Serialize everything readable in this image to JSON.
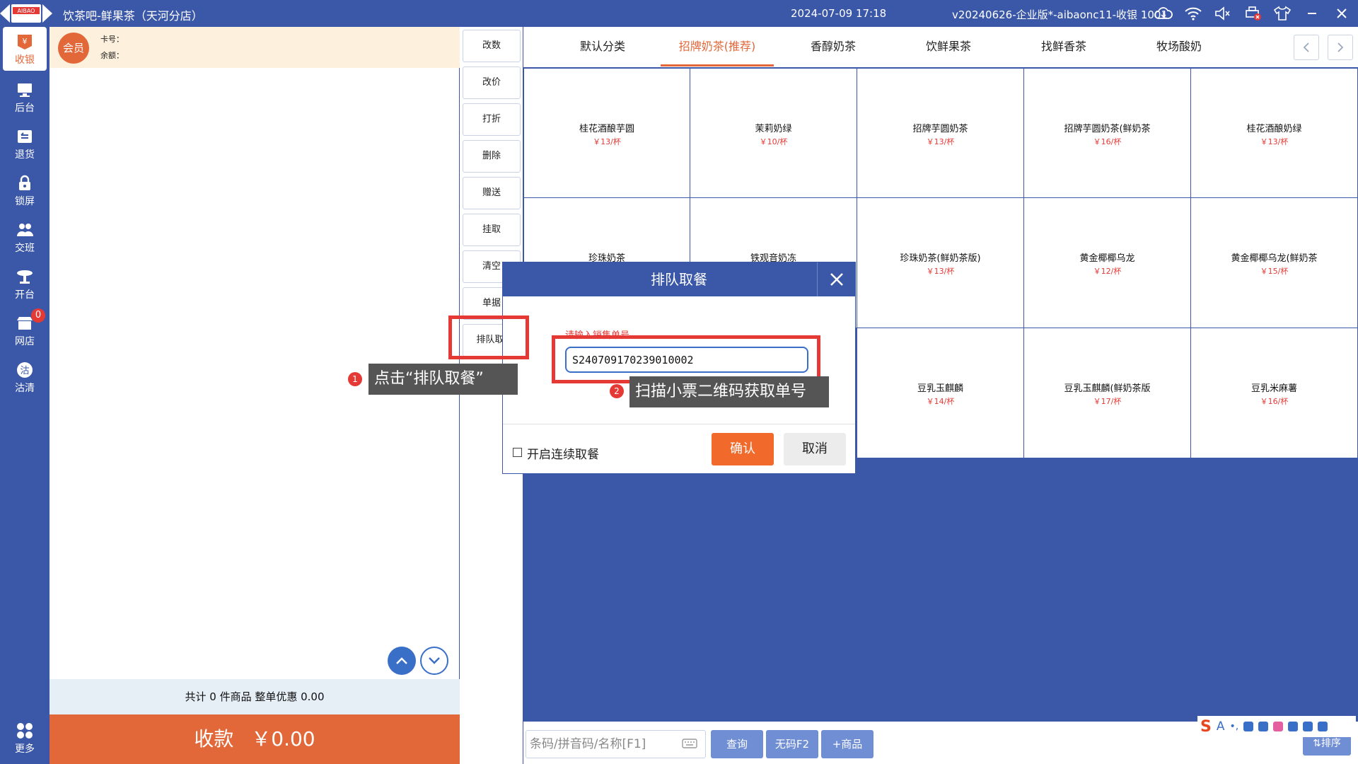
{
  "titlebar": {
    "logo_text": "AIBAO",
    "app_title": "饮茶吧-鲜果茶（天河分店）",
    "datetime": "2024-07-09 17:18",
    "version": "v20240626-企业版*-aibaonc11-收银 1001",
    "icons": [
      "cloud-sync-icon",
      "wifi-icon",
      "volume-mute-icon",
      "printer-error-icon",
      "shirt-icon",
      "minimize-icon",
      "close-icon"
    ]
  },
  "nav": {
    "items": [
      {
        "label": "收银",
        "icon": "cashier-icon",
        "active": true
      },
      {
        "label": "后台",
        "icon": "monitor-icon"
      },
      {
        "label": "退货",
        "icon": "return-icon"
      },
      {
        "label": "锁屏",
        "icon": "lock-icon"
      },
      {
        "label": "交班",
        "icon": "handover-icon"
      },
      {
        "label": "开台",
        "icon": "table-icon"
      },
      {
        "label": "网店",
        "icon": "store-icon",
        "badge": "0"
      },
      {
        "label": "沽清",
        "icon": "soldout-icon"
      },
      {
        "label": "更多",
        "icon": "more-icon"
      }
    ]
  },
  "member": {
    "avatar_label": "会员",
    "card_label": "卡号：",
    "balance_label": "余额："
  },
  "order": {
    "summary": "共计 0 件商品 整单优惠 0.00",
    "pay_label": "收款",
    "pay_amount": "￥0.00"
  },
  "actions": [
    "改数",
    "改价",
    "打折",
    "删除",
    "赠送",
    "挂取",
    "清空",
    "单据",
    "排队取"
  ],
  "categories": {
    "tabs": [
      "默认分类",
      "招牌奶茶(推荐)",
      "香醇奶茶",
      "饮鲜果茶",
      "找鲜香茶",
      "牧场酸奶"
    ],
    "active_index": 1
  },
  "products": [
    {
      "name": "桂花酒酿芋圆",
      "price": "￥13/杯"
    },
    {
      "name": "茉莉奶绿",
      "price": "￥10/杯"
    },
    {
      "name": "招牌芋圆奶茶",
      "price": "￥13/杯"
    },
    {
      "name": "招牌芋圆奶茶(鲜奶茶",
      "price": "￥16/杯"
    },
    {
      "name": "桂花酒酿奶绿",
      "price": "￥13/杯"
    },
    {
      "name": "珍珠奶茶",
      "price": ""
    },
    {
      "name": "铁观音奶冻",
      "price": ""
    },
    {
      "name": "珍珠奶茶(鲜奶茶版)",
      "price": "￥13/杯"
    },
    {
      "name": "黄金椰椰乌龙",
      "price": "￥12/杯"
    },
    {
      "name": "黄金椰椰乌龙(鲜奶茶",
      "price": "￥15/杯"
    },
    {
      "name": "豆乳玉麒麟",
      "price": "￥14/杯"
    },
    {
      "name": "豆乳玉麒麟(鲜奶茶版",
      "price": "￥17/杯"
    },
    {
      "name": "豆乳米麻薯",
      "price": "￥16/杯"
    }
  ],
  "bottom": {
    "search_placeholder": "条码/拼音码/名称[F1]",
    "query_label": "查询",
    "nocode_label": "无码F2",
    "add_product_label": "+商品",
    "sort_label": "⇅排序"
  },
  "dialog": {
    "title": "排队取餐",
    "input_label": "请输入销售单号",
    "order_number": "S240709170239010002",
    "continuous_label": "开启连续取餐",
    "confirm_label": "确认",
    "cancel_label": "取消"
  },
  "annotations": {
    "step1_num": "1",
    "step1_text": "点击“排队取餐”",
    "step2_num": "2",
    "step2_text": "扫描小票二维码获取单号",
    "highlight_color": "#e53935"
  },
  "colors": {
    "primary": "#3a57a8",
    "accent": "#e2683a",
    "price": "#e53935"
  }
}
